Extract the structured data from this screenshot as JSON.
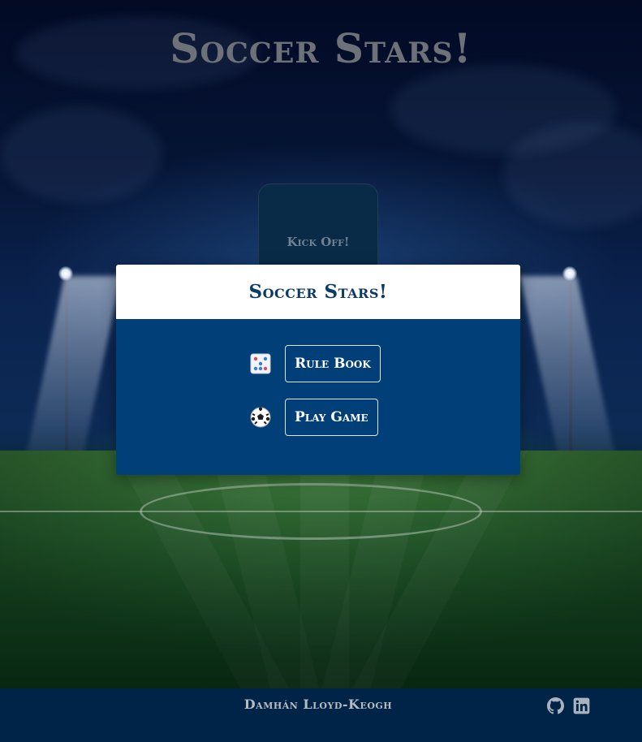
{
  "header": {
    "title": "Soccer Stars!"
  },
  "kickoff": {
    "label": "Kick Off!"
  },
  "modal": {
    "title": "Soccer Stars!",
    "items": [
      {
        "icon": "dice-icon",
        "label": "Rule Book"
      },
      {
        "icon": "soccer-ball-icon",
        "label": "Play Game"
      }
    ]
  },
  "footer": {
    "author": "Damhán Lloyd-Keogh",
    "links": [
      {
        "icon": "github-icon"
      },
      {
        "icon": "linkedin-icon"
      }
    ]
  },
  "colors": {
    "modal_body": "#003f77",
    "modal_header_text": "#0b3a66",
    "footer_bg": "#002447",
    "title_text": "#6d7278"
  }
}
